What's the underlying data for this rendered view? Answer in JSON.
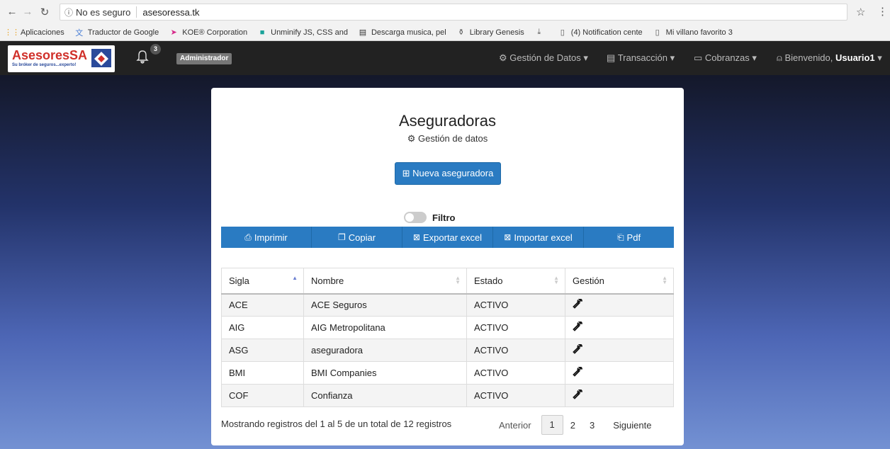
{
  "browser": {
    "insecure_label": "No es seguro",
    "url": "asesoressa.tk",
    "bookmarks": [
      {
        "label": "Aplicaciones",
        "icon": "apps-grid-icon",
        "color": "#e8a11c"
      },
      {
        "label": "Traductor de Google",
        "icon": "translate-icon",
        "color": "#4a7fd6"
      },
      {
        "label": "KOE® Corporation",
        "icon": "koe-logo-icon",
        "color": "#d62a8a"
      },
      {
        "label": "Unminify JS, CSS and",
        "icon": "square-icon",
        "color": "#1aa39a"
      },
      {
        "label": "Descarga musica, pel",
        "icon": "page-icon",
        "color": "#333333"
      },
      {
        "label": "Library Genesis",
        "icon": "library-icon",
        "color": "#555555"
      },
      {
        "label": "",
        "icon": "download-icon",
        "color": "#555555"
      },
      {
        "label": "(4) Notification cente",
        "icon": "document-icon",
        "color": "#555555"
      },
      {
        "label": "Mi villano favorito 3",
        "icon": "document-icon",
        "color": "#555555"
      }
    ]
  },
  "app": {
    "logo_text": "AsesoresSA",
    "logo_tagline": "Su bróker de seguros...experto!",
    "notification_count": "3",
    "role": "Administrador",
    "nav": {
      "data_management": "Gestión de Datos",
      "transaction": "Transacción",
      "collections": "Cobranzas",
      "welcome": "Bienvenido,",
      "user": "Usuario1"
    }
  },
  "page": {
    "title": "Aseguradoras",
    "subtitle": "Gestión de datos",
    "new_button": "Nueva aseguradora",
    "filter_label": "Filtro",
    "toolbar": {
      "print": "Imprimir",
      "copy": "Copiar",
      "export_excel": "Exportar excel",
      "import_excel": "Importar excel",
      "pdf": "Pdf"
    },
    "table": {
      "headers": {
        "sigla": "Sigla",
        "nombre": "Nombre",
        "estado": "Estado",
        "gestion": "Gestión"
      },
      "rows": [
        {
          "sigla": "ACE",
          "nombre": "ACE Seguros",
          "estado": "ACTIVO"
        },
        {
          "sigla": "AIG",
          "nombre": "AIG Metropolitana",
          "estado": "ACTIVO"
        },
        {
          "sigla": "ASG",
          "nombre": "aseguradora",
          "estado": "ACTIVO"
        },
        {
          "sigla": "BMI",
          "nombre": "BMI Companies",
          "estado": "ACTIVO"
        },
        {
          "sigla": "COF",
          "nombre": "Confianza",
          "estado": "ACTIVO"
        }
      ]
    },
    "footer_info": "Mostrando registros del 1 al 5 de un total de 12 registros",
    "pagination": {
      "previous": "Anterior",
      "pages": [
        "1",
        "2",
        "3"
      ],
      "next": "Siguiente",
      "current": "1"
    }
  },
  "colors": {
    "primary": "#2a7bc2",
    "navbar": "#222222",
    "logo_red": "#d0302a"
  }
}
